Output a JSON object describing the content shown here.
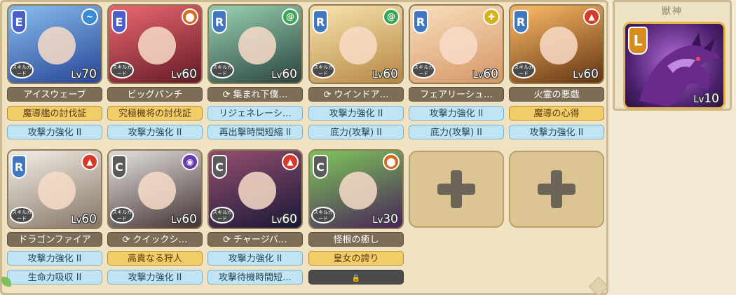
{
  "beast_panel": {
    "title": "獣神",
    "card": {
      "rarity": "L",
      "level_prefix": "Lv",
      "level": "10"
    }
  },
  "skill_card_label": "スキルカード",
  "units": [
    {
      "rarity": "E",
      "element": "water",
      "element_glyph": "~",
      "element_color": "#3a8ad6",
      "level_prefix": "Lv",
      "level": "70",
      "art": [
        "#7fb3e6",
        "#2c4a9a"
      ],
      "skill": "アイスウェーブ",
      "skill_swap": false,
      "abilities": [
        {
          "label": "魔導艦の討伐証",
          "style": "gold"
        },
        {
          "label": "攻撃力強化 II",
          "style": "blue"
        }
      ]
    },
    {
      "rarity": "E",
      "element": "fire",
      "element_glyph": "⬤",
      "element_color": "#d66a1e",
      "level_prefix": "Lv",
      "level": "60",
      "art": [
        "#e0616a",
        "#6a1e2a"
      ],
      "skill": "ビッグパンチ",
      "skill_swap": false,
      "abilities": [
        {
          "label": "究極機将の討伐証",
          "style": "gold"
        },
        {
          "label": "攻撃力強化 II",
          "style": "blue"
        }
      ]
    },
    {
      "rarity": "R",
      "element": "wind",
      "element_glyph": "@",
      "element_color": "#3aa655",
      "level_prefix": "Lv",
      "level": "60",
      "art": [
        "#8fc6a8",
        "#2f4a44"
      ],
      "skill": "集まれ下僕…",
      "skill_swap": true,
      "abilities": [
        {
          "label": "リジェネレーシ…",
          "style": "blue"
        },
        {
          "label": "再出撃時間短縮 II",
          "style": "blue"
        }
      ]
    },
    {
      "rarity": "R",
      "element": "wind",
      "element_glyph": "@",
      "element_color": "#3aa655",
      "level_prefix": "Lv",
      "level": "60",
      "art": [
        "#f2dca4",
        "#b98a4a"
      ],
      "skill": "ウインドア…",
      "skill_swap": true,
      "abilities": [
        {
          "label": "攻撃力強化 II",
          "style": "blue"
        },
        {
          "label": "底力(攻撃) II",
          "style": "blue"
        }
      ]
    },
    {
      "rarity": "R",
      "element": "light",
      "element_glyph": "✚",
      "element_color": "#d6b21e",
      "level_prefix": "Lv",
      "level": "60",
      "art": [
        "#f6d8b4",
        "#d69a6a"
      ],
      "skill": "フェアリーシュ…",
      "skill_swap": false,
      "abilities": [
        {
          "label": "攻撃力強化 II",
          "style": "blue"
        },
        {
          "label": "底力(攻撃) II",
          "style": "blue"
        }
      ]
    },
    {
      "rarity": "R",
      "element": "fire",
      "element_glyph": "▲",
      "element_color": "#d63a2a",
      "level_prefix": "Lv",
      "level": "60",
      "art": [
        "#f0b060",
        "#6a3a14"
      ],
      "skill": "火霊の悪戯",
      "skill_swap": false,
      "abilities": [
        {
          "label": "魔導の心得",
          "style": "gold"
        },
        {
          "label": "攻撃力強化 II",
          "style": "blue"
        }
      ]
    },
    {
      "rarity": "R",
      "element": "fire",
      "element_glyph": "▲",
      "element_color": "#d63a2a",
      "level_prefix": "Lv",
      "level": "60",
      "art": [
        "#eae4dc",
        "#8a7a6a"
      ],
      "skill": "ドラゴンファイア",
      "skill_swap": false,
      "abilities": [
        {
          "label": "攻撃力強化 II",
          "style": "blue"
        },
        {
          "label": "生命力吸収 II",
          "style": "blue"
        }
      ]
    },
    {
      "rarity": "C",
      "element": "dark",
      "element_glyph": "◉",
      "element_color": "#6a3ab0",
      "level_prefix": "Lv",
      "level": "60",
      "art": [
        "#d6d2d0",
        "#4a3a3a"
      ],
      "skill": "クイックシ…",
      "skill_swap": true,
      "abilities": [
        {
          "label": "高貴なる狩人",
          "style": "gold"
        },
        {
          "label": "攻撃力強化 II",
          "style": "blue"
        }
      ]
    },
    {
      "rarity": "C",
      "element": "fire",
      "element_glyph": "▲",
      "element_color": "#d63a2a",
      "level_prefix": "Lv",
      "level": "60",
      "art": [
        "#8a4a6a",
        "#1e1a3a"
      ],
      "skill": "チャージバ…",
      "skill_swap": true,
      "abilities": [
        {
          "label": "攻撃力強化 II",
          "style": "blue"
        },
        {
          "label": "攻撃待機時間短…",
          "style": "blue"
        }
      ]
    },
    {
      "rarity": "C",
      "element": "fire",
      "element_glyph": "⬤",
      "element_color": "#d66a1e",
      "level_prefix": "Lv",
      "level": "30",
      "art": [
        "#7ab85a",
        "#4a2a5a"
      ],
      "skill": "怪根の癒し",
      "skill_swap": false,
      "abilities": [
        {
          "label": "皇女の誇り",
          "style": "gold"
        },
        {
          "label": "",
          "style": "locked"
        }
      ]
    }
  ],
  "empty_slots": 2
}
